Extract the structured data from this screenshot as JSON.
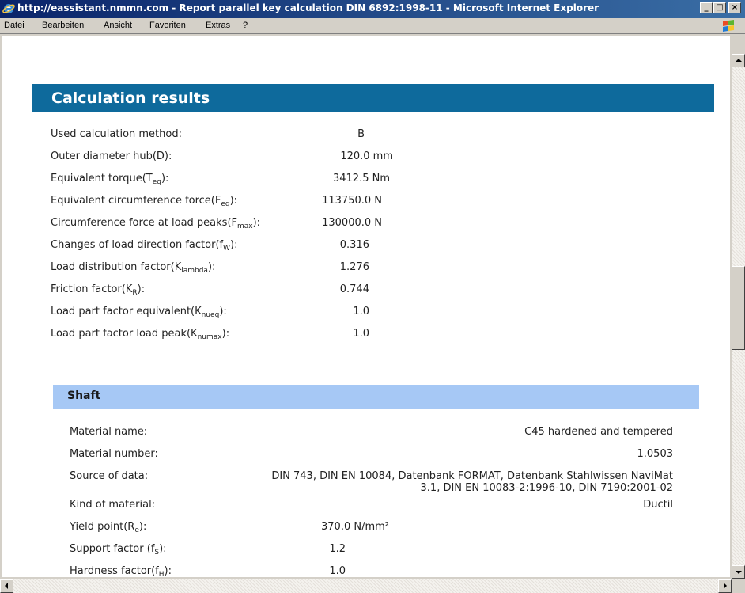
{
  "window": {
    "title": "http://eassistant.nmmn.com - Report parallel key calculation DIN 6892:1998-11 - Microsoft Internet Explorer",
    "minimize": "_",
    "maximize": "□",
    "close": "×"
  },
  "menu": {
    "items": [
      "Datei",
      "Bearbeiten",
      "Ansicht",
      "Favoriten",
      "Extras",
      "?"
    ]
  },
  "results": {
    "title": "Calculation results",
    "rows": [
      {
        "label": "Used calculation method:",
        "value": "B"
      },
      {
        "label": "Outer diameter hub(D):",
        "value": "120.0 mm"
      },
      {
        "label": "Equivalent torque(T",
        "sub": "eq",
        "suffix": "):",
        "value": "3412.5 Nm"
      },
      {
        "label": "Equivalent circumference force(F",
        "sub": "eq",
        "suffix": "):",
        "value": "113750.0 N"
      },
      {
        "label": "Circumference force at load peaks(F",
        "sub": "max",
        "suffix": "):",
        "value": "130000.0 N"
      },
      {
        "label": "Changes of load direction factor(f",
        "sub": "W",
        "suffix": "):",
        "value": "0.316"
      },
      {
        "label": "Load distribution factor(K",
        "sub": "lambda",
        "suffix": "):",
        "value": "1.276"
      },
      {
        "label": "Friction factor(K",
        "sub": "R",
        "suffix": "):",
        "value": "0.744"
      },
      {
        "label": "Load part factor equivalent(K",
        "sub": "nueq",
        "suffix": "):",
        "value": "1.0"
      },
      {
        "label": "Load part factor load peak(K",
        "sub": "numax",
        "suffix": "):",
        "value": "1.0"
      }
    ]
  },
  "shaft": {
    "title": "Shaft",
    "material_name_label": "Material name:",
    "material_name": "C45 hardened and tempered",
    "material_number_label": "Material number:",
    "material_number": "1.0503",
    "source_label": "Source of data:",
    "source_line1": "DIN 743, DIN EN 10084, Datenbank FORMAT, Datenbank Stahlwissen NaviMat",
    "source_line2": "3.1, DIN EN 10083-2:1996-10, DIN 7190:2001-02",
    "kind_label": "Kind of material:",
    "kind": "Ductil",
    "yield_label": "Yield point(R",
    "yield_sub": "e",
    "yield_suffix": "):",
    "yield_value": "370.0 N/mm²",
    "support_label": "Support factor (f",
    "support_sub": "S",
    "support_suffix": "):",
    "support_value": "1.2",
    "hardness_label": "Hardness factor(f",
    "hardness_sub": "H",
    "hardness_suffix": "):",
    "hardness_value": "1.0"
  },
  "colors": {
    "results_header": "#0e6a9c",
    "shaft_header": "#a6c8f5",
    "titlebar": "#0a246a"
  }
}
